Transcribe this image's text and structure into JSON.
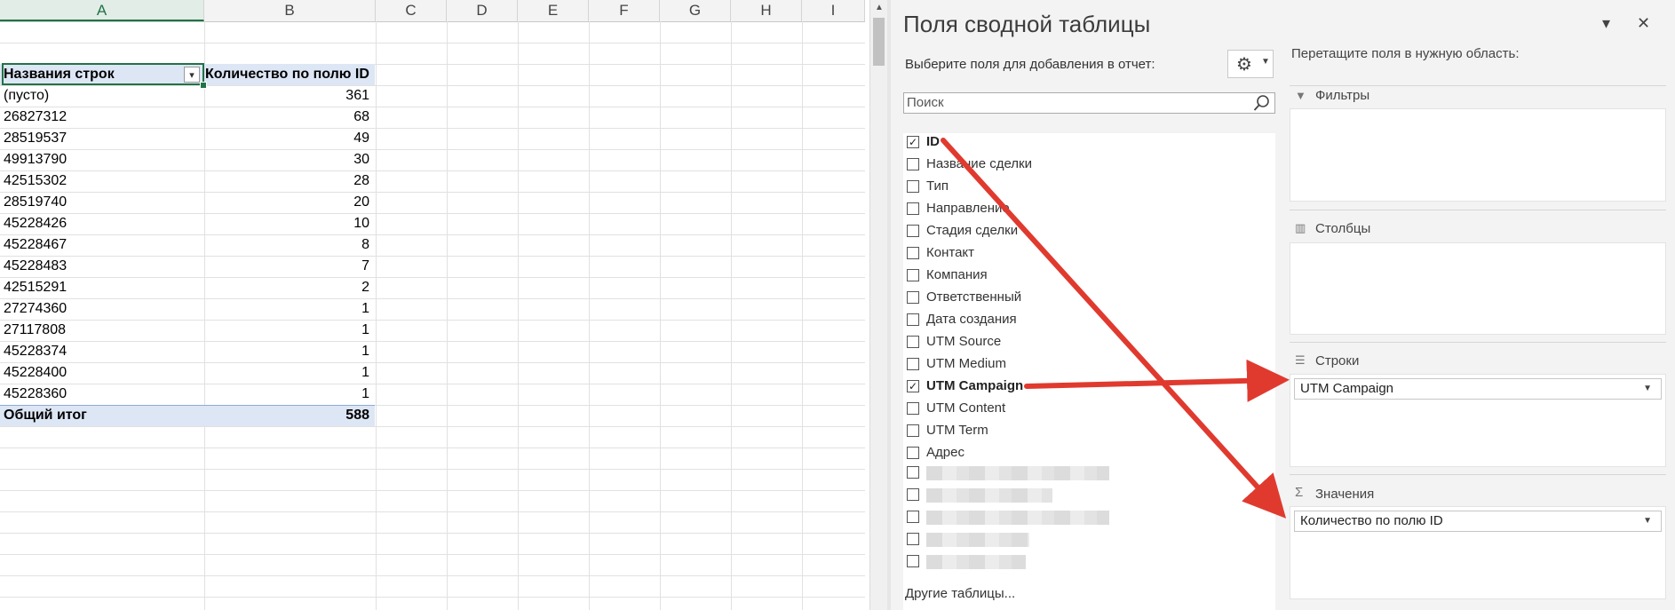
{
  "sheet": {
    "columns": [
      "A",
      "B",
      "C",
      "D",
      "E",
      "F",
      "G",
      "H",
      "I"
    ],
    "pivot_header": {
      "row_label": "Названия строк",
      "value_label": "Количество по полю ID"
    },
    "rows": [
      {
        "label": "(пусто)",
        "value": "361"
      },
      {
        "label": "26827312",
        "value": "68"
      },
      {
        "label": "28519537",
        "value": "49"
      },
      {
        "label": "49913790",
        "value": "30"
      },
      {
        "label": "42515302",
        "value": "28"
      },
      {
        "label": "28519740",
        "value": "20"
      },
      {
        "label": "45228426",
        "value": "10"
      },
      {
        "label": "45228467",
        "value": "8"
      },
      {
        "label": "45228483",
        "value": "7"
      },
      {
        "label": "42515291",
        "value": "2"
      },
      {
        "label": "27274360",
        "value": "1"
      },
      {
        "label": "27117808",
        "value": "1"
      },
      {
        "label": "45228374",
        "value": "1"
      },
      {
        "label": "45228400",
        "value": "1"
      },
      {
        "label": "45228360",
        "value": "1"
      }
    ],
    "total": {
      "label": "Общий итог",
      "value": "588"
    }
  },
  "pane": {
    "title": "Поля сводной таблицы",
    "choose_label": "Выберите поля для добавления в отчет:",
    "search_placeholder": "Поиск",
    "fields": [
      {
        "label": "ID",
        "checked": true
      },
      {
        "label": "Название сделки",
        "checked": false
      },
      {
        "label": "Тип",
        "checked": false
      },
      {
        "label": "Направление",
        "checked": false
      },
      {
        "label": "Стадия сделки",
        "checked": false
      },
      {
        "label": "Контакт",
        "checked": false
      },
      {
        "label": "Компания",
        "checked": false
      },
      {
        "label": "Ответственный",
        "checked": false
      },
      {
        "label": "Дата создания",
        "checked": false
      },
      {
        "label": "UTM Source",
        "checked": false
      },
      {
        "label": "UTM Medium",
        "checked": false
      },
      {
        "label": "UTM Campaign",
        "checked": true
      },
      {
        "label": "UTM Content",
        "checked": false
      },
      {
        "label": "UTM Term",
        "checked": false
      },
      {
        "label": "Адрес",
        "checked": false
      }
    ],
    "other_tables": "Другие таблицы...",
    "drag_label": "Перетащите поля в нужную область:",
    "areas": {
      "filters": "Фильтры",
      "columns": "Столбцы",
      "rows": "Строки",
      "values": "Значения"
    },
    "rows_item": "UTM Campaign",
    "values_item": "Количество по полю ID",
    "arrow_color": "#e03a2f"
  }
}
